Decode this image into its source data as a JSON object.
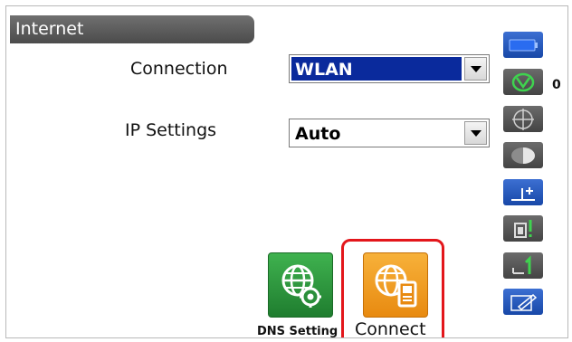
{
  "title": "Internet",
  "connection": {
    "label": "Connection",
    "value": "WLAN"
  },
  "ip_settings": {
    "label": "IP Settings",
    "value": "Auto"
  },
  "buttons": {
    "dns": "DNS Setting",
    "connect": "Connect"
  },
  "side_panel": {
    "icons": [
      "battery-icon",
      "target-mode-icon",
      "crosshair-icon",
      "half-circle-icon",
      "height-plus-icon",
      "reflector-icon",
      "target-height-icon",
      "edit-icon"
    ],
    "counter": "0"
  },
  "colors": {
    "selected_bg": "#0a2a9c",
    "dns_button": "#2e9a3f",
    "connect_button": "#f0a02a",
    "highlight": "#e3161b",
    "side_panel": "#555555",
    "side_panel_blue": "#1f57c0"
  }
}
